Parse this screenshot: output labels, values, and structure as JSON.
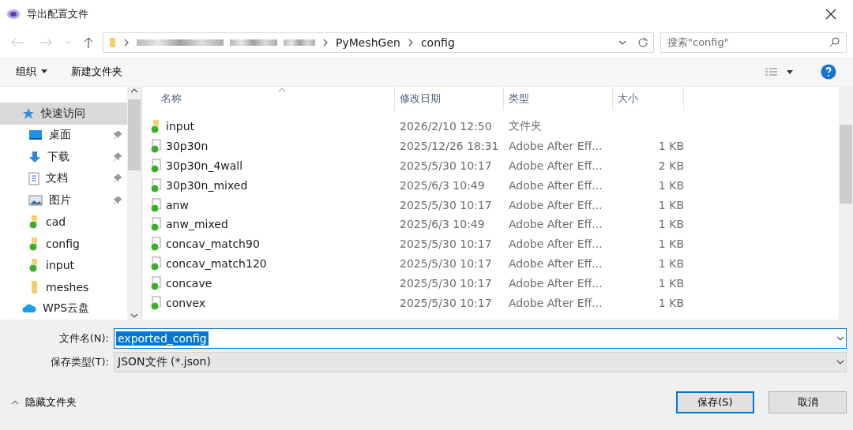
{
  "window": {
    "title": "导出配置文件"
  },
  "address": {
    "path": [
      "PyMeshGen",
      "config"
    ]
  },
  "search": {
    "placeholder": "搜索\"config\""
  },
  "toolbar": {
    "organize": "组织",
    "new_folder": "新建文件夹"
  },
  "sidebar": {
    "items": [
      {
        "label": "快速访问",
        "kind": "star",
        "selected": true,
        "pinned": false,
        "sub": false
      },
      {
        "label": "桌面",
        "kind": "desktop",
        "selected": false,
        "pinned": true,
        "sub": true
      },
      {
        "label": "下载",
        "kind": "download",
        "selected": false,
        "pinned": true,
        "sub": true
      },
      {
        "label": "文档",
        "kind": "document",
        "selected": false,
        "pinned": true,
        "sub": true
      },
      {
        "label": "图片",
        "kind": "picture-folder",
        "selected": false,
        "pinned": true,
        "sub": true
      },
      {
        "label": "cad",
        "kind": "synced-folder",
        "selected": false,
        "pinned": false,
        "sub": true
      },
      {
        "label": "config",
        "kind": "synced-folder",
        "selected": false,
        "pinned": false,
        "sub": true
      },
      {
        "label": "input",
        "kind": "synced-folder",
        "selected": false,
        "pinned": false,
        "sub": true
      },
      {
        "label": "meshes",
        "kind": "folder",
        "selected": false,
        "pinned": false,
        "sub": true
      },
      {
        "label": "WPS云盘",
        "kind": "cloud",
        "selected": false,
        "pinned": false,
        "sub": false
      }
    ]
  },
  "table": {
    "columns": [
      {
        "label": "名称",
        "sorted": true
      },
      {
        "label": "修改日期",
        "sorted": false
      },
      {
        "label": "类型",
        "sorted": false
      },
      {
        "label": "大小",
        "sorted": false
      }
    ],
    "rows": [
      {
        "name": "input",
        "date": "2026/2/10 12:50",
        "type": "文件夹",
        "size": "",
        "kind": "folder"
      },
      {
        "name": "30p30n",
        "date": "2025/12/26 18:31",
        "type": "Adobe After Eff...",
        "size": "1 KB",
        "kind": "file"
      },
      {
        "name": "30p30n_4wall",
        "date": "2025/5/30 10:17",
        "type": "Adobe After Eff...",
        "size": "2 KB",
        "kind": "file"
      },
      {
        "name": "30p30n_mixed",
        "date": "2025/6/3 10:49",
        "type": "Adobe After Eff...",
        "size": "1 KB",
        "kind": "file"
      },
      {
        "name": "anw",
        "date": "2025/5/30 10:17",
        "type": "Adobe After Eff...",
        "size": "1 KB",
        "kind": "file"
      },
      {
        "name": "anw_mixed",
        "date": "2025/6/3 10:49",
        "type": "Adobe After Eff...",
        "size": "1 KB",
        "kind": "file"
      },
      {
        "name": "concav_match90",
        "date": "2025/5/30 10:17",
        "type": "Adobe After Eff...",
        "size": "1 KB",
        "kind": "file"
      },
      {
        "name": "concav_match120",
        "date": "2025/5/30 10:17",
        "type": "Adobe After Eff...",
        "size": "1 KB",
        "kind": "file"
      },
      {
        "name": "concave",
        "date": "2025/5/30 10:17",
        "type": "Adobe After Eff...",
        "size": "1 KB",
        "kind": "file"
      },
      {
        "name": "convex",
        "date": "2025/5/30 10:17",
        "type": "Adobe After Eff...",
        "size": "1 KB",
        "kind": "file"
      }
    ]
  },
  "filename": {
    "label": "文件名(N):",
    "value": "exported_config",
    "text_selected": true
  },
  "filetype": {
    "label": "保存类型(T):",
    "value": "JSON文件 (*.json)"
  },
  "hide_folders": "隐藏文件夹",
  "buttons": [
    {
      "label": "保存(S)",
      "primary": true
    },
    {
      "label": "取消",
      "primary": false
    }
  ]
}
